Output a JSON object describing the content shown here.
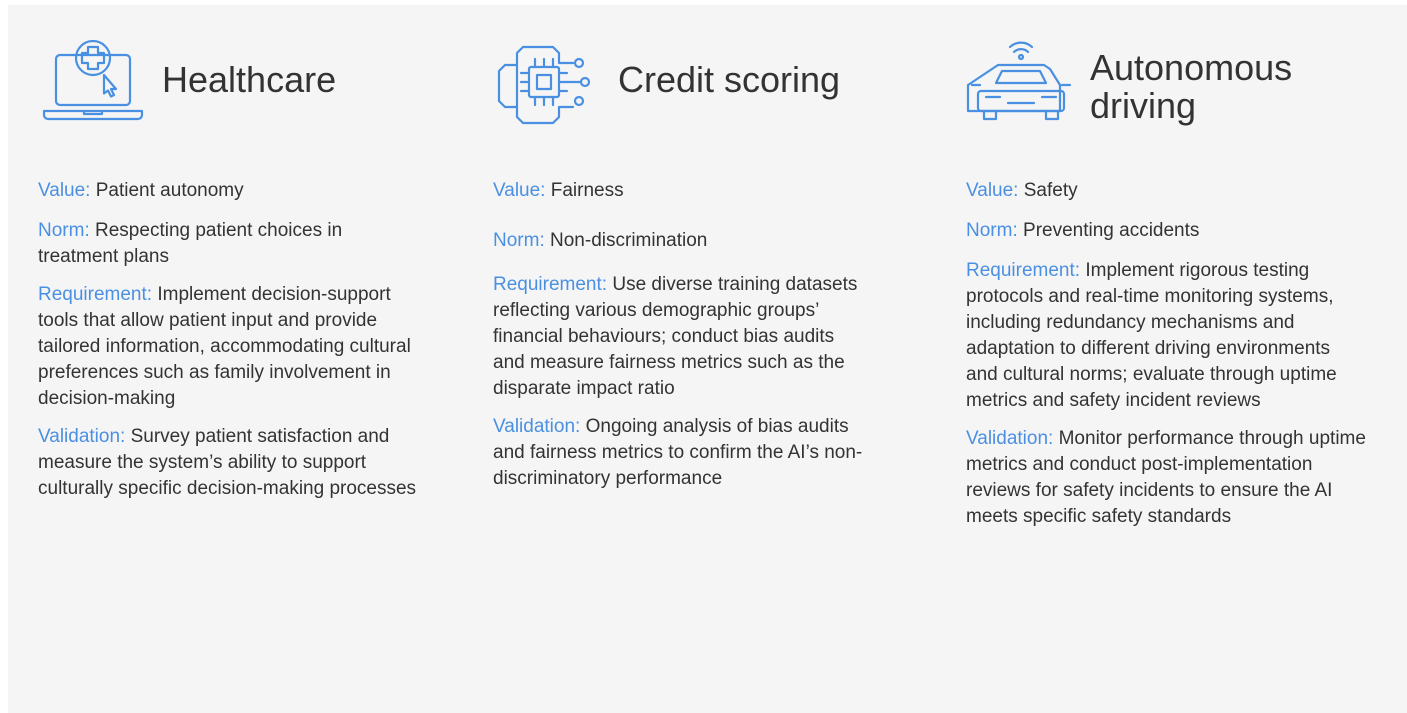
{
  "columns": [
    {
      "title": "Healthcare",
      "icon": "laptop-medical-cross-icon",
      "value_label": "Value:",
      "value": "Patient autonomy",
      "norm_label": "Norm:",
      "norm": "Respecting patient choices in treatment plans",
      "requirement_label": "Requirement:",
      "requirement": "Implement decision-support tools that allow patient input and provide tailored information, accommodating cultural preferences such as family involvement in decision-making",
      "validation_label": "Validation:",
      "validation": "Survey patient satisfaction and measure the system’s ability to support culturally specific decision-making processes"
    },
    {
      "title": "Credit scoring",
      "icon": "chip-circuit-icon",
      "value_label": "Value:",
      "value": "Fairness",
      "norm_label": "Norm:",
      "norm": "Non-discrimination",
      "requirement_label": "Requirement:",
      "requirement": "Use diverse training datasets reflecting various demographic groups’ financial behaviours; conduct bias audits and measure fairness metrics such as the disparate impact ratio",
      "validation_label": "Validation:",
      "validation": "Ongoing analysis of bias audits and fairness metrics to confirm the AI’s non-discriminatory performance"
    },
    {
      "title": "Autonomous driving",
      "icon": "autonomous-car-icon",
      "value_label": "Value:",
      "value": "Safety",
      "norm_label": "Norm:",
      "norm": "Preventing accidents",
      "requirement_label": "Requirement:",
      "requirement": "Implement rigorous testing protocols and real-time monitoring systems, including redundancy mechanisms and adaptation to different driving environments and cultural norms; evaluate through uptime metrics and safety incident reviews",
      "validation_label": "Validation:",
      "validation": "Monitor performance through uptime metrics and conduct post-implementation reviews for safety incidents to ensure the AI meets specific safety standards"
    }
  ],
  "colors": {
    "accent": "#4a90e2",
    "text": "#333333",
    "panel": "#f5f5f5"
  }
}
